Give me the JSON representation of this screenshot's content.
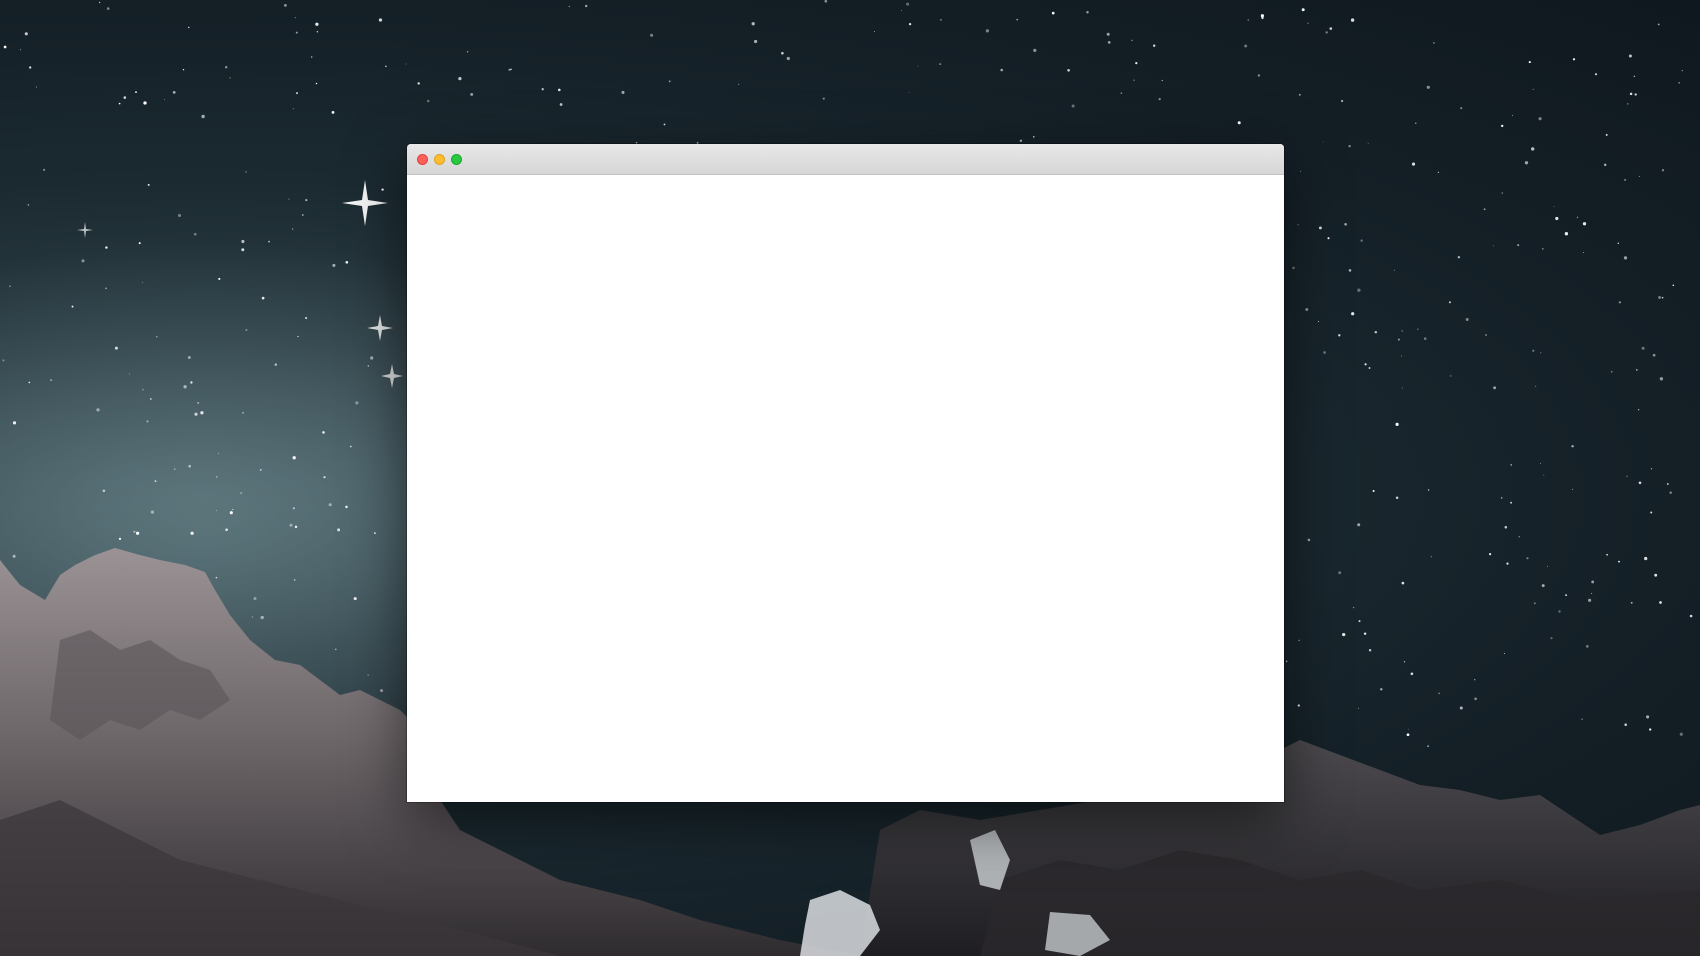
{
  "desktop": {
    "wallpaper": "night-sky-mountains",
    "colors": {
      "sky_dark": "#0f181e",
      "sky_glow": "#4a5f66",
      "rock_light": "#8b8486",
      "rock_dark": "#2c2a2d"
    }
  },
  "window": {
    "title": "",
    "controls": {
      "close_color": "#fe5f57",
      "minimize_color": "#febc2e",
      "zoom_color": "#28c840"
    }
  }
}
